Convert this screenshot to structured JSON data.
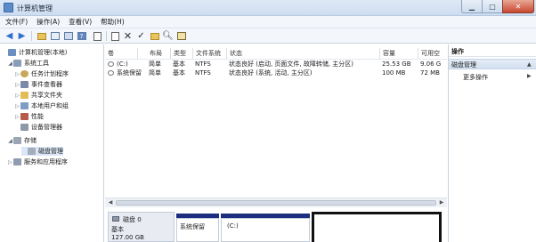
{
  "window": {
    "title": "计算机管理"
  },
  "menu": [
    "文件(F)",
    "操作(A)",
    "查看(V)",
    "帮助(H)"
  ],
  "toolbar_icons": [
    "back-arrow-icon",
    "forward-arrow-icon",
    "up-folder-icon",
    "show-tree-icon",
    "help-icon",
    "properties-icon",
    "delete-icon",
    "refresh-icon",
    "open-folder-icon",
    "find-icon",
    "view-icon"
  ],
  "tree": [
    {
      "label": "计算机管理(本地)",
      "depth": 0,
      "expander": ""
    },
    {
      "label": "系统工具",
      "depth": 1,
      "expander": "◢"
    },
    {
      "label": "任务计划程序",
      "depth": 2,
      "expander": "▷"
    },
    {
      "label": "事件查看器",
      "depth": 2,
      "expander": "▷"
    },
    {
      "label": "共享文件夹",
      "depth": 2,
      "expander": "▷"
    },
    {
      "label": "本地用户和组",
      "depth": 2,
      "expander": "▷"
    },
    {
      "label": "性能",
      "depth": 2,
      "expander": "▷"
    },
    {
      "label": "设备管理器",
      "depth": 2,
      "expander": ""
    },
    {
      "label": "存储",
      "depth": 1,
      "expander": "◢"
    },
    {
      "label": "磁盘管理",
      "depth": 2,
      "expander": ""
    },
    {
      "label": "服务和应用程序",
      "depth": 1,
      "expander": "▷"
    }
  ],
  "volumes": {
    "columns": [
      "卷",
      "布局",
      "类型",
      "文件系统",
      "状态",
      "容量",
      "可用空"
    ],
    "rows": [
      [
        "(C:)",
        "简单",
        "基本",
        "NTFS",
        "状态良好 (启动, 页面文件, 故障转储, 主分区)",
        "25.53 GB",
        "9.06 G"
      ],
      [
        "系统保留",
        "简单",
        "基本",
        "NTFS",
        "状态良好 (系统, 活动, 主分区)",
        "100 MB",
        "72 MB"
      ]
    ]
  },
  "disk": {
    "name": "磁盘 0",
    "type": "基本",
    "size": "127.00 GB",
    "partitions": [
      "系统保留",
      "(C:)"
    ]
  },
  "actions": {
    "header": "操作",
    "section": "磁盘管理",
    "item": "更多操作"
  },
  "colors": {
    "partition_bar": "#1d2d80",
    "selected_row": "#3399ff"
  }
}
